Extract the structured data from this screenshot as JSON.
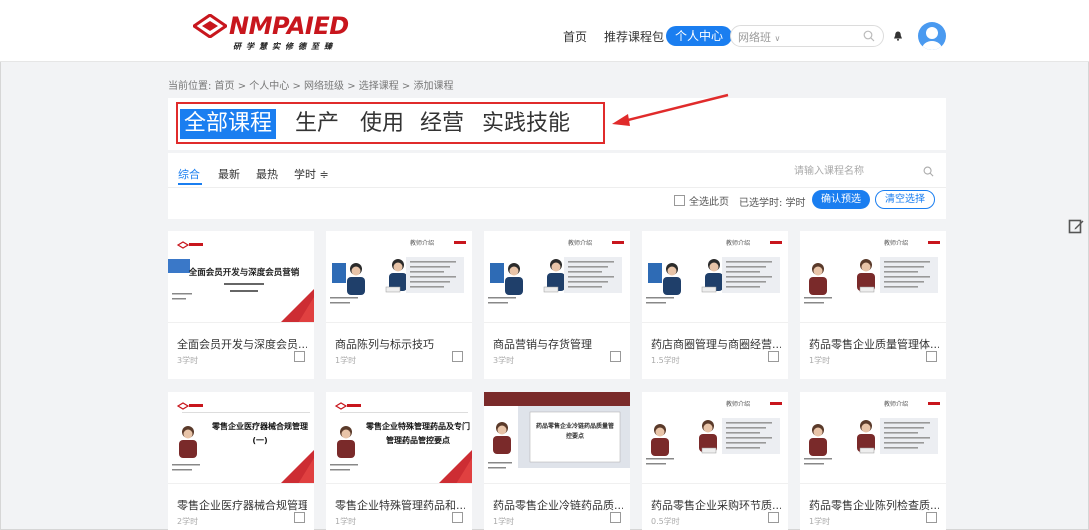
{
  "header": {
    "logo_text": "NMPAIED",
    "logo_subtitle": "研学慧实修德至臻",
    "nav_home": "首页",
    "nav_packages": "推荐课程包",
    "nav_center": "个人中心",
    "search_select": "网络班",
    "search_select_chevron": "∨",
    "brand_color": "#c8161d",
    "accent_color": "#1a7ef0"
  },
  "breadcrumb": "当前位置: 首页 > 个人中心 > 网络班级 > 选择课程 > 添加课程",
  "categories": [
    "全部课程",
    "生产",
    "使用",
    "经营",
    "实践技能"
  ],
  "filter": {
    "tabs": [
      "综合",
      "最新",
      "最热",
      "学时 ≑"
    ],
    "search_placeholder": "请输入课程名称",
    "select_page_label": "全选此页",
    "selected_hours_label": "已选学时: 学时",
    "confirm_button": "确认预选",
    "clear_button": "清空选择"
  },
  "courses": [
    {
      "title": "全面会员开发与深度会员...",
      "hours": "3学时",
      "slide_text": "全面会员开发与深度会员营销",
      "kind": "title"
    },
    {
      "title": "商品陈列与标示技巧",
      "hours": "1学时",
      "slide_text": "教师介绍",
      "kind": "intro"
    },
    {
      "title": "商品营销与存货管理",
      "hours": "3学时",
      "slide_text": "教师介绍",
      "kind": "intro"
    },
    {
      "title": "药店商圈管理与商圈经营...",
      "hours": "1.5学时",
      "slide_text": "教师介绍",
      "kind": "intro"
    },
    {
      "title": "药品零售企业质量管理体...",
      "hours": "1学时",
      "slide_text": "教师介绍",
      "kind": "intro-f"
    },
    {
      "title": "零售企业医疗器械合规管理",
      "hours": "2学时",
      "slide_text": "零售企业医疗器械合规管理 (一)",
      "kind": "title-f"
    },
    {
      "title": "零售企业特殊管理药品和...",
      "hours": "1学时",
      "slide_text": "零售企业特殊管理药品及专门管理药品管控要点",
      "kind": "title-f"
    },
    {
      "title": "药品零售企业冷链药品质...",
      "hours": "1学时",
      "slide_text": "药品零售企业冷链药品质量管控要点",
      "kind": "screen"
    },
    {
      "title": "药品零售企业采购环节质...",
      "hours": "0.5学时",
      "slide_text": "教师介绍",
      "kind": "intro-f"
    },
    {
      "title": "药品零售企业陈列检查质...",
      "hours": "1学时",
      "slide_text": "教师介绍",
      "kind": "intro-f"
    }
  ]
}
